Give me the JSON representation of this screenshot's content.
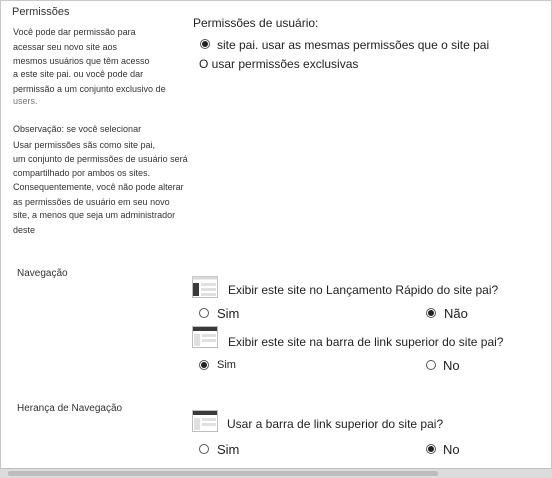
{
  "permissions": {
    "title": "Permissões",
    "description": [
      "Você pode dar permissão para",
      "acessar seu novo site aos",
      "mesmos usuários que têm acesso",
      "a este site pai. ou você pode dar",
      "permissão a um conjunto exclusivo de",
      "users."
    ],
    "note": [
      "Observação: se você selecionar",
      "Usar permissões sãs como site pai,",
      "um conjunto de permissões de usuário será",
      "compartilhado por ambos os sites.",
      "Consequentemente, você não pode alterar",
      "as permissões de usuário em seu novo",
      "site, a menos que seja um administrador",
      "deste"
    ],
    "field_label": "Permissões de usuário:",
    "option_same": "site pai. usar as mesmas permissões que o site pai",
    "option_unique": "O usar permissões exclusivas",
    "selected": "same"
  },
  "navigation": {
    "title": "Navegação",
    "quick_launch_question": "Exibir este site no Lançamento Rápido do site pai?",
    "quick_launch_yes": "Sim",
    "quick_launch_no": "Não",
    "quick_launch_selected": "no",
    "top_link_question": "Exibir este site na barra de link superior do site pai?",
    "top_link_yes": "Sim",
    "top_link_no": "No",
    "top_link_selected": "yes"
  },
  "navigation_inheritance": {
    "title": "Herança de Navegação",
    "question": "Usar a barra de link superior do site pai?",
    "yes": "Sim",
    "no": "No",
    "selected": "no"
  }
}
